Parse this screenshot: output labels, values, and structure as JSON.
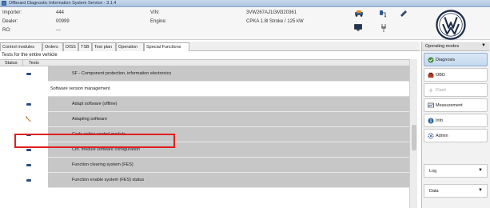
{
  "window": {
    "title": "Offboard Diagnostic Information System Service - 3.1.4"
  },
  "info": {
    "importer_label": "Importer:",
    "importer_value": "444",
    "dealer_label": "Dealer:",
    "dealer_value": "00999",
    "ro_label": "RO:",
    "ro_value": "---",
    "vin_label": "VIN:",
    "vin_value": "3VW267AJ1GM320361",
    "engine_label": "Engine:",
    "engine_value": "CPKA 1.8l Stroke / 125 kW"
  },
  "tabs": [
    {
      "label": "Control modules",
      "active": false
    },
    {
      "label": "Orders",
      "active": false
    },
    {
      "label": "DISS",
      "active": false
    },
    {
      "label": "TSB",
      "active": false
    },
    {
      "label": "Test plan",
      "active": false
    },
    {
      "label": "Operation",
      "active": false
    },
    {
      "label": "Special Functions",
      "active": true
    }
  ],
  "section_title": "Tests for the entire vehicle",
  "columns": {
    "status": "Status",
    "tests": "Tests"
  },
  "rows": [
    {
      "text": "SF - Component protection, information electronics",
      "status_icon": "dash-icon",
      "group": false
    },
    {
      "text": "Software version management",
      "status_icon": "none",
      "group": true
    },
    {
      "text": "Adapt software (offline)",
      "status_icon": "dash-icon",
      "group": false
    },
    {
      "text": "Adapting software",
      "status_icon": "pen-icon",
      "group": false
    },
    {
      "text": "Code online control module",
      "status_icon": "dash-icon",
      "group": false
    },
    {
      "text": "Ctrl. module software configuration",
      "status_icon": "dash-icon",
      "group": false
    },
    {
      "text": "Function clearing system (FES)",
      "status_icon": "dash-icon",
      "group": false
    },
    {
      "text": "Function enable system (FES) status",
      "status_icon": "dash-icon",
      "group": false
    }
  ],
  "right_panel": {
    "header": "Operating modes",
    "header_arrow": "▼",
    "buttons": [
      {
        "label": "Diagnosis",
        "icon": "diagnosis-icon",
        "selected": true,
        "enabled": true
      },
      {
        "label": "OBD",
        "icon": "obd-icon",
        "selected": false,
        "enabled": true
      },
      {
        "label": "Flash",
        "icon": "flash-icon",
        "selected": false,
        "enabled": false
      },
      {
        "label": "Measurement",
        "icon": "measurement-icon",
        "selected": false,
        "enabled": true
      },
      {
        "label": "Info",
        "icon": "info-icon",
        "selected": false,
        "enabled": true
      },
      {
        "label": "Admin",
        "icon": "admin-icon",
        "selected": false,
        "enabled": true
      }
    ],
    "log_label": "Log",
    "data_label": "Data",
    "dropdown_arrow": "▼"
  },
  "colors": {
    "highlight": "#e02020",
    "row_fill": "#c7c7c7",
    "selected_mode": "#c3d8ef",
    "dash": "#2a4f82"
  }
}
